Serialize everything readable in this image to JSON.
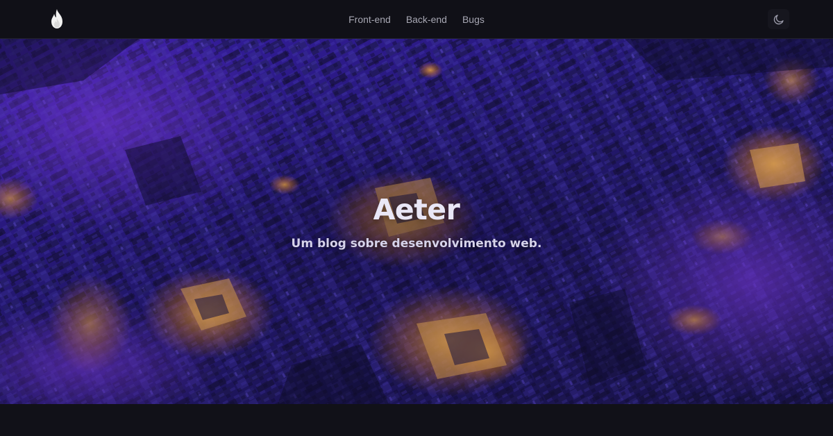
{
  "navbar": {
    "logo_icon": "flame-icon",
    "links": [
      {
        "label": "Front-end"
      },
      {
        "label": "Back-end"
      },
      {
        "label": "Bugs"
      }
    ],
    "theme_toggle_icon": "moon-icon"
  },
  "hero": {
    "title": "Aeter",
    "subtitle": "Um blog sobre desenvolvimento web.",
    "background_image": "isometric-purple-circuit-city"
  },
  "colors": {
    "page_background": "#111118",
    "navbar_background": "#101017",
    "nav_text": "#a7a7b3",
    "hero_purple": "#3a22a8",
    "hero_orange": "#f0a040",
    "hero_text": "#e9e7f6"
  }
}
